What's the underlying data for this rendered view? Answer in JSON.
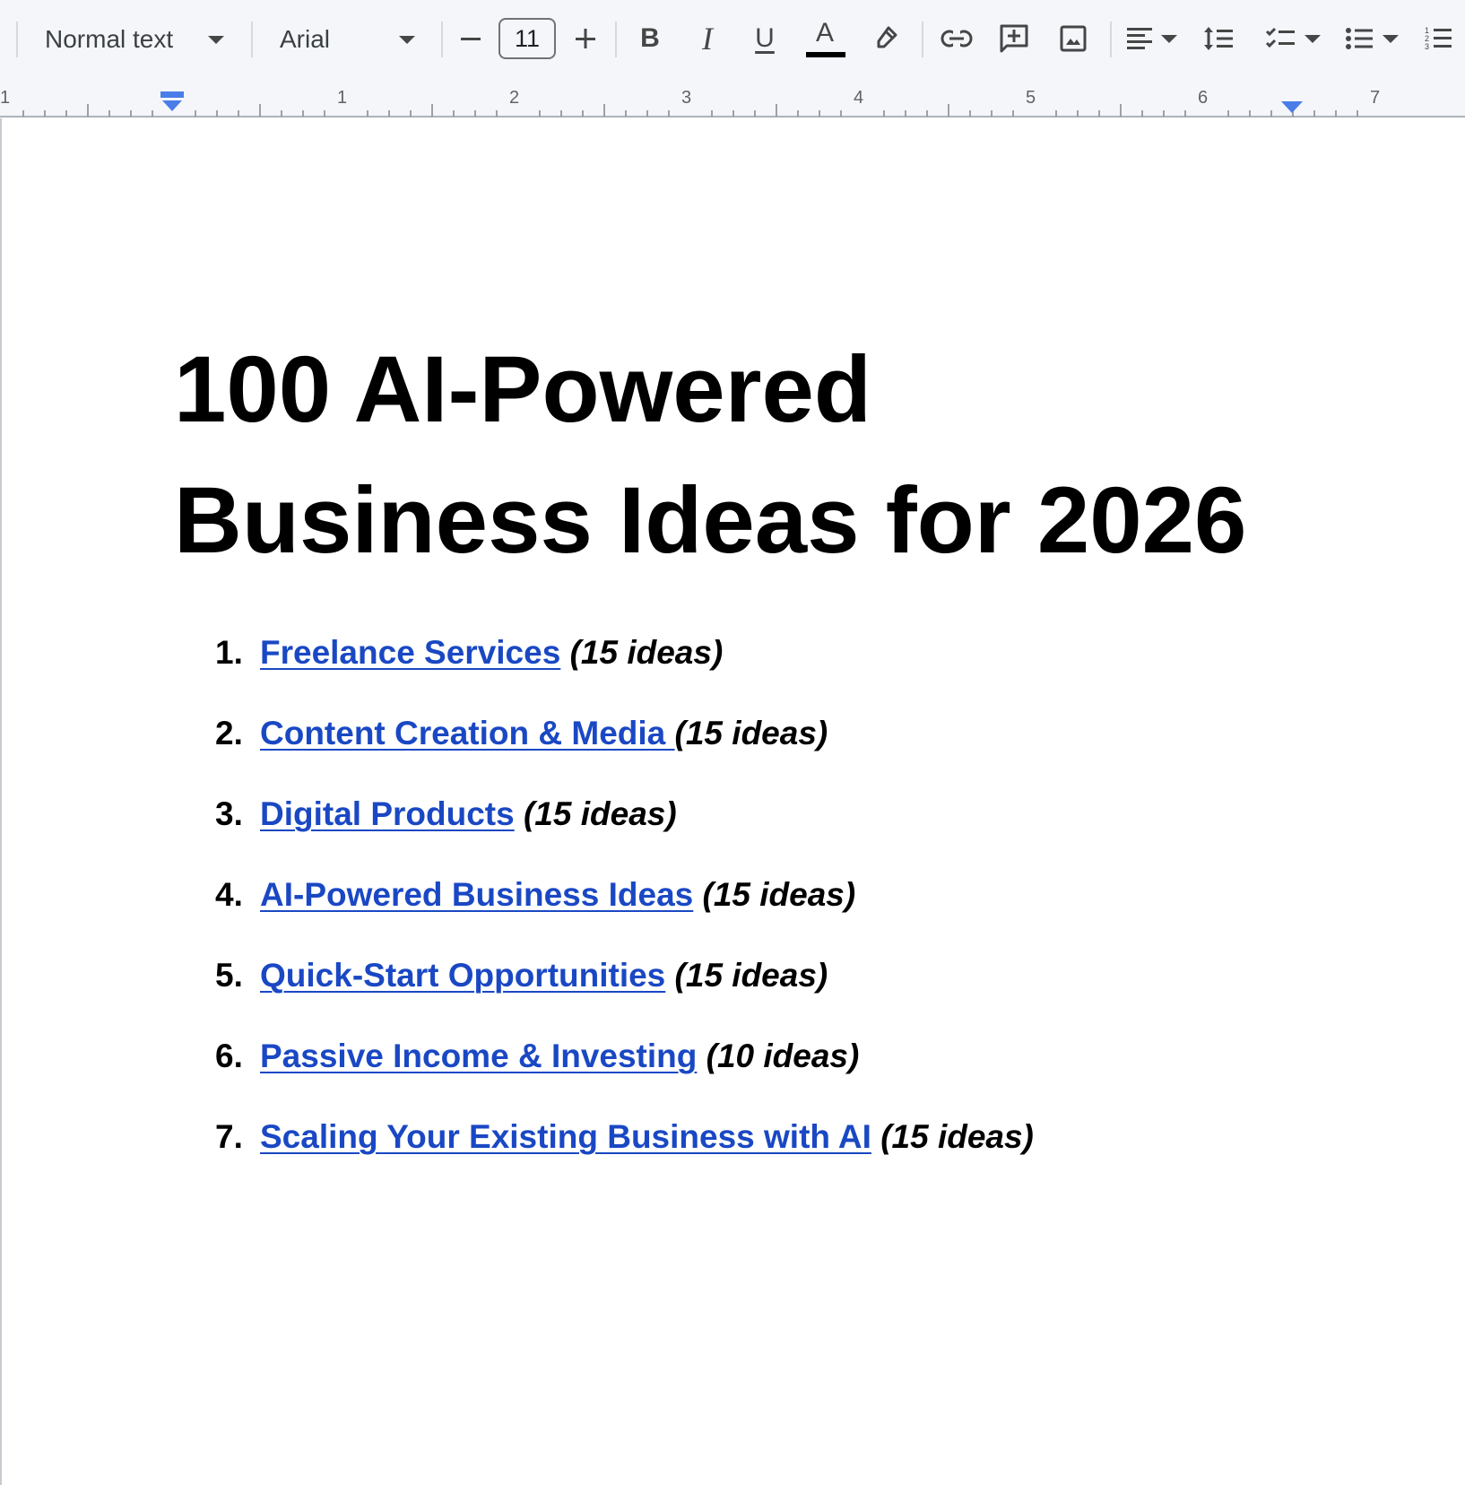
{
  "toolbar": {
    "paragraph_style": "Normal text",
    "font_name": "Arial",
    "font_size": "11",
    "buttons": {
      "decrease_size": "minus-icon",
      "increase_size": "plus-icon",
      "bold": "B",
      "italic": "I",
      "underline": "U",
      "text_color": "A",
      "text_color_value": "#000000",
      "highlight": "highlighter-icon",
      "link": "link-icon",
      "comment": "add-comment-icon",
      "image": "image-icon",
      "align": "align-left-icon",
      "line_spacing": "line-spacing-icon",
      "checklist": "checklist-icon",
      "bulleted_list": "bulleted-list-icon",
      "numbered_list": "numbered-list-icon"
    }
  },
  "ruler": {
    "labels": [
      "1",
      "1",
      "2",
      "3",
      "4",
      "5",
      "6",
      "7"
    ],
    "left_indent_marker": "indent-marker-icon",
    "right_indent_marker": "indent-marker-icon"
  },
  "document": {
    "title_line1": "100 AI-Powered",
    "title_line2": "Business Ideas for 2026",
    "items": [
      {
        "number": "1.",
        "link": "Freelance Services",
        "count": "(15 ideas)",
        "sep": " "
      },
      {
        "number": "2.",
        "link": "Content Creation & Media ",
        "count": "(15 ideas)",
        "sep": ""
      },
      {
        "number": "3.",
        "link": "Digital Products",
        "count": "(15 ideas)",
        "sep": " "
      },
      {
        "number": "4.",
        "link": "AI-Powered Business Ideas",
        "count": "(15 ideas)",
        "sep": " "
      },
      {
        "number": "5.",
        "link": "Quick-Start Opportunities",
        "count": "(15 ideas)",
        "sep": " "
      },
      {
        "number": "6.",
        "link": "Passive Income & Investing",
        "count": "(10 ideas)",
        "sep": " "
      },
      {
        "number": "7.",
        "link": "Scaling Your Existing Business with AI",
        "count": "(15 ideas)",
        "sep": " "
      }
    ],
    "link_color": "#1a48c4"
  }
}
